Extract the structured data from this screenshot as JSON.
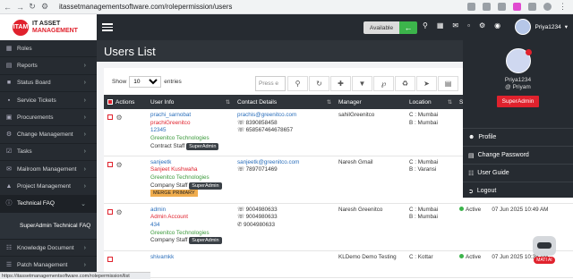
{
  "browser": {
    "url": "itassetmanagementsoftware.com/rolepermission/users"
  },
  "logo": {
    "badge": "ITAM",
    "line1": "IT ASSET",
    "line2": "MANAGEMENT"
  },
  "sidebar": {
    "items": [
      {
        "label": "Roles"
      },
      {
        "label": "Reports"
      },
      {
        "label": "Status Board"
      },
      {
        "label": "Service Tickets"
      },
      {
        "label": "Procurements"
      },
      {
        "label": "Change Management"
      },
      {
        "label": "Tasks"
      },
      {
        "label": "Mailroom Management"
      },
      {
        "label": "Project Management"
      },
      {
        "label": "Technical FAQ"
      },
      {
        "label": "SuperAdmin Technical FAQ"
      },
      {
        "label": "Knowledge Document"
      },
      {
        "label": "Patch Management"
      }
    ]
  },
  "topbar": {
    "available_label": "Available",
    "username": "Priya1234"
  },
  "page": {
    "title": "Users List"
  },
  "controls": {
    "show_label": "Show",
    "entries_value": "10",
    "entries_label": "entries",
    "search_placeholder": "Press e"
  },
  "table": {
    "headers": [
      "Actions",
      "User Info",
      "Contact Details",
      "Manager",
      "Location",
      "St"
    ],
    "rows": [
      {
        "name": "prachi_sarnobat",
        "full": "prachiGreenitco",
        "id": "12345",
        "org": "Greenitco Technologies",
        "type": "Contract Staff",
        "role": "SuperAdmin",
        "extra": "",
        "email": "prachis@greenitco.com",
        "phone1": "8390858458",
        "phone2": "658567464678657",
        "phone3": "",
        "manager": "sahilGreenitco",
        "loc1": "C : Mumbai",
        "loc2": "B : Mumbai",
        "status": "",
        "date": ""
      },
      {
        "name": "sanjeetk",
        "full": "Sanjeet Kushwaha",
        "id": "",
        "org": "Greenitco Technologies",
        "type": "Company Staff",
        "role": "SuperAdmin",
        "extra": "MERGE PRIMARY",
        "email": "sanjeetk@greenitco.com",
        "phone1": "7897071469",
        "phone2": "",
        "phone3": "",
        "manager": "Naresh Gmail",
        "loc1": "C : Mumbai",
        "loc2": "B : Varansi",
        "status": "",
        "date": ""
      },
      {
        "name": "admin",
        "full": "Admin Account",
        "id": "434",
        "org": "Greenitco Technologies",
        "type": "Company Staff",
        "role": "SuperAdmin",
        "extra": "",
        "email": "",
        "phone1": "9004980633",
        "phone2": "9004980633",
        "phone3": "9004980633",
        "manager": "Naresh Greenitco",
        "loc1": "C : Mumbai",
        "loc2": "B : Mumbai",
        "status": "Active",
        "date": "07 Jun 2025 10:49 AM"
      },
      {
        "name": "shivamkk",
        "full": "",
        "id": "",
        "org": "",
        "type": "",
        "role": "",
        "extra": "",
        "email": "",
        "phone1": "",
        "phone2": "",
        "phone3": "",
        "manager": "KLDemo Demo Testing",
        "loc1": "C : Kottar",
        "loc2": "",
        "status": "Active",
        "date": "07 Jun 2025 10:35 AM"
      }
    ]
  },
  "dropdown": {
    "name": "Priya1234",
    "handle": "@ Priyam",
    "role": "SuperAdmin",
    "items": [
      {
        "label": "Profile"
      },
      {
        "label": "Change Password"
      },
      {
        "label": "User Guide"
      },
      {
        "label": "Logout"
      }
    ]
  },
  "status_url": "https://itassetmanagementsoftware.com/rolepermission/list",
  "assistant": {
    "label": "MATI AI"
  }
}
